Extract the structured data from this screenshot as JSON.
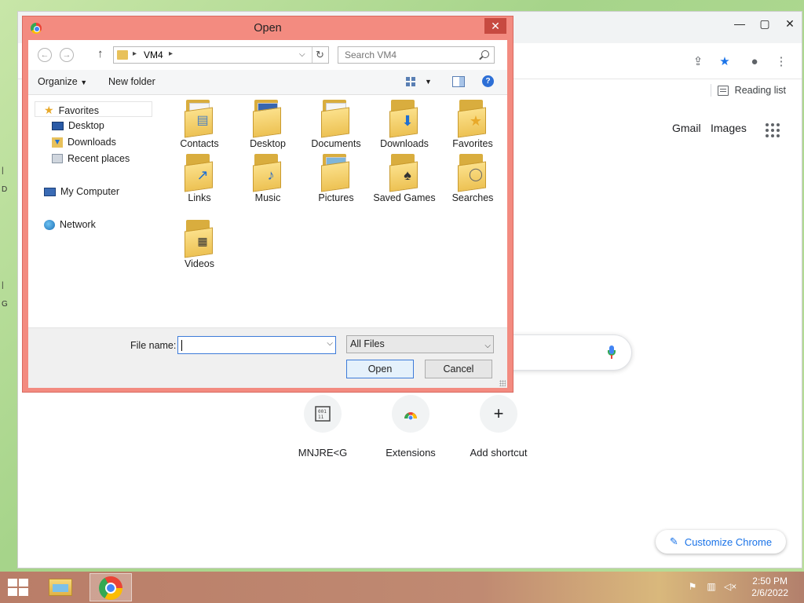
{
  "chrome": {
    "reading_list_label": "Reading list",
    "gmail_label": "Gmail",
    "images_label": "Images",
    "shortcuts": [
      {
        "label": "MNJRE<G",
        "icon": "binary-icon"
      },
      {
        "label": "Extensions",
        "icon": "chrome-web-store-icon"
      },
      {
        "label": "Add shortcut",
        "icon": "plus-icon"
      }
    ],
    "customize_label": "Customize Chrome",
    "accent_color": "#1a73e8"
  },
  "dialog": {
    "title": "Open",
    "address_path": "VM4",
    "search_placeholder": "Search VM4",
    "organize_label": "Organize",
    "new_folder_label": "New folder",
    "nav_items": [
      {
        "label": "Favorites",
        "icon": "star-icon"
      },
      {
        "label": "Desktop",
        "icon": "desktop-icon"
      },
      {
        "label": "Downloads",
        "icon": "downloads-icon"
      },
      {
        "label": "Recent places",
        "icon": "recent-places-icon"
      },
      {
        "label": "My Computer",
        "icon": "computer-icon"
      },
      {
        "label": "Network",
        "icon": "network-icon"
      }
    ],
    "files": [
      {
        "label": "Contacts",
        "icon": "contacts-folder-icon"
      },
      {
        "label": "Desktop",
        "icon": "desktop-folder-icon"
      },
      {
        "label": "Documents",
        "icon": "documents-folder-icon"
      },
      {
        "label": "Downloads",
        "icon": "downloads-folder-icon"
      },
      {
        "label": "Favorites",
        "icon": "favorites-folder-icon"
      },
      {
        "label": "Links",
        "icon": "links-folder-icon"
      },
      {
        "label": "Music",
        "icon": "music-folder-icon"
      },
      {
        "label": "Pictures",
        "icon": "pictures-folder-icon"
      },
      {
        "label": "Saved Games",
        "icon": "saved-games-folder-icon"
      },
      {
        "label": "Searches",
        "icon": "searches-folder-icon"
      },
      {
        "label": "Videos",
        "icon": "videos-folder-icon"
      }
    ],
    "file_name_label": "File name:",
    "file_name_value": "",
    "file_type_value": "All Files",
    "open_button": "Open",
    "cancel_button": "Cancel",
    "title_color": "#f38b80"
  },
  "taskbar": {
    "time": "2:50 PM",
    "date": "2/6/2022"
  }
}
